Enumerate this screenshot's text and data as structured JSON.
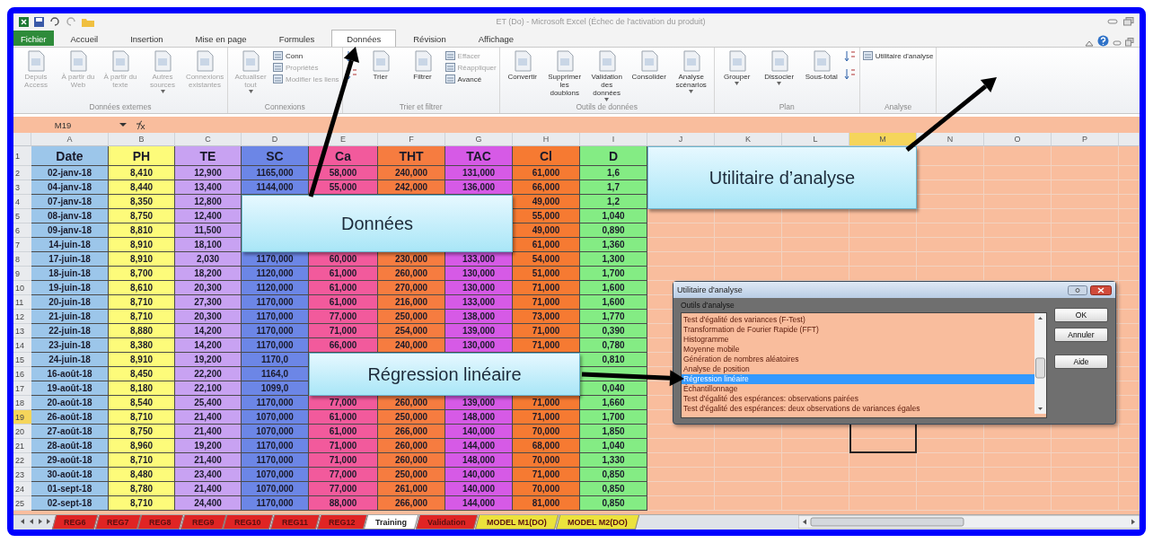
{
  "window": {
    "title": "ET (Do)  -  Microsoft Excel (Échec de l'activation du produit)"
  },
  "ribbon_tabs": [
    {
      "label": "Fichier",
      "kind": "file",
      "selected": false
    },
    {
      "label": "Accueil",
      "kind": "tab",
      "selected": false
    },
    {
      "label": "Insertion",
      "kind": "tab",
      "selected": false
    },
    {
      "label": "Mise en page",
      "kind": "tab",
      "selected": false
    },
    {
      "label": "Formules",
      "kind": "tab",
      "selected": false
    },
    {
      "label": "Données",
      "kind": "tab",
      "selected": true
    },
    {
      "label": "Révision",
      "kind": "tab",
      "selected": false
    },
    {
      "label": "Affichage",
      "kind": "tab",
      "selected": false
    }
  ],
  "ribbon_groups": [
    {
      "label": "Données externes",
      "items": [
        {
          "kind": "large",
          "label": "Depuis Access",
          "disabled": true,
          "dropdown": false
        },
        {
          "kind": "large",
          "label": "À partir du Web",
          "disabled": true,
          "dropdown": false
        },
        {
          "kind": "large",
          "label": "À partir du texte",
          "disabled": true,
          "dropdown": false
        },
        {
          "kind": "large",
          "label": "Autres sources",
          "disabled": true,
          "dropdown": true
        },
        {
          "kind": "large",
          "label": "Connexions existantes",
          "disabled": true,
          "dropdown": false
        }
      ]
    },
    {
      "label": "Connexions",
      "items": [
        {
          "kind": "large",
          "label": "Actualiser tout",
          "disabled": true,
          "dropdown": true
        },
        {
          "kind": "stack",
          "items": [
            {
              "label": "Conn",
              "disabled": false
            },
            {
              "label": "Propriétés",
              "disabled": true
            },
            {
              "label": "Modifier les liens",
              "disabled": true
            }
          ]
        }
      ]
    },
    {
      "label": "Trier et filtrer",
      "items": [
        {
          "kind": "sort"
        },
        {
          "kind": "large",
          "label": "Trier",
          "disabled": false,
          "dropdown": false
        },
        {
          "kind": "large",
          "label": "Filtrer",
          "disabled": false,
          "dropdown": false
        },
        {
          "kind": "stack",
          "items": [
            {
              "label": "Effacer",
              "disabled": true
            },
            {
              "label": "Réappliquer",
              "disabled": true
            },
            {
              "label": "Avancé",
              "disabled": false
            }
          ]
        }
      ]
    },
    {
      "label": "Outils de données",
      "items": [
        {
          "kind": "large",
          "label": "Convertir",
          "disabled": false,
          "dropdown": false
        },
        {
          "kind": "large",
          "label": "Supprimer les doublons",
          "disabled": false,
          "dropdown": false
        },
        {
          "kind": "large",
          "label": "Validation des données",
          "disabled": false,
          "dropdown": true
        },
        {
          "kind": "large",
          "label": "Consolider",
          "disabled": false,
          "dropdown": false
        },
        {
          "kind": "large",
          "label": "Analyse scénarios",
          "disabled": false,
          "dropdown": true
        }
      ]
    },
    {
      "label": "Plan",
      "items": [
        {
          "kind": "large",
          "label": "Grouper",
          "disabled": false,
          "dropdown": true
        },
        {
          "kind": "large",
          "label": "Dissocier",
          "disabled": false,
          "dropdown": true
        },
        {
          "kind": "large",
          "label": "Sous-total",
          "disabled": false,
          "dropdown": false
        },
        {
          "kind": "sort"
        }
      ]
    },
    {
      "label": "Analyse",
      "items": [
        {
          "kind": "stack",
          "items": [
            {
              "label": "Utilitaire d'analyse",
              "disabled": false
            }
          ]
        }
      ]
    }
  ],
  "formula_bar": {
    "name_box": "M19"
  },
  "columns": [
    {
      "label": "A",
      "selected": false
    },
    {
      "label": "B",
      "selected": false
    },
    {
      "label": "C",
      "selected": false
    },
    {
      "label": "D",
      "selected": false
    },
    {
      "label": "E",
      "selected": false
    },
    {
      "label": "F",
      "selected": false
    },
    {
      "label": "G",
      "selected": false
    },
    {
      "label": "H",
      "selected": false
    },
    {
      "label": "I",
      "selected": false
    },
    {
      "label": "J",
      "selected": false
    },
    {
      "label": "K",
      "selected": false
    },
    {
      "label": "L",
      "selected": false
    },
    {
      "label": "M",
      "selected": true
    },
    {
      "label": "N",
      "selected": false
    },
    {
      "label": "O",
      "selected": false
    },
    {
      "label": "P",
      "selected": false
    }
  ],
  "rows": [
    {
      "number": "1",
      "selected": false,
      "cells": [
        "Date",
        "PH",
        "TE",
        "SC",
        "Ca",
        "THT",
        "TAC",
        "Cl",
        "D"
      ]
    },
    {
      "number": "2",
      "selected": false,
      "cells": [
        "02-janv-18",
        "8,410",
        "12,900",
        "1165,000",
        "58,000",
        "240,000",
        "131,000",
        "61,000",
        "1,6"
      ]
    },
    {
      "number": "3",
      "selected": false,
      "cells": [
        "04-janv-18",
        "8,440",
        "13,400",
        "1144,000",
        "55,000",
        "242,000",
        "136,000",
        "66,000",
        "1,7"
      ]
    },
    {
      "number": "4",
      "selected": false,
      "cells": [
        "07-janv-18",
        "8,350",
        "12,800",
        null,
        null,
        null,
        null,
        "49,000",
        "1,2"
      ]
    },
    {
      "number": "5",
      "selected": false,
      "cells": [
        "08-janv-18",
        "8,750",
        "12,400",
        null,
        null,
        null,
        null,
        "55,000",
        "1,040"
      ]
    },
    {
      "number": "6",
      "selected": false,
      "cells": [
        "09-janv-18",
        "8,810",
        "11,500",
        null,
        null,
        null,
        null,
        "49,000",
        "0,890"
      ]
    },
    {
      "number": "7",
      "selected": false,
      "cells": [
        "14-juin-18",
        "8,910",
        "18,100",
        null,
        null,
        null,
        null,
        "61,000",
        "1,360"
      ]
    },
    {
      "number": "8",
      "selected": false,
      "cells": [
        "17-juin-18",
        "8,910",
        "2,030",
        "1170,000",
        "60,000",
        "230,000",
        "133,000",
        "54,000",
        "1,300"
      ]
    },
    {
      "number": "9",
      "selected": false,
      "cells": [
        "18-juin-18",
        "8,700",
        "18,200",
        "1120,000",
        "61,000",
        "260,000",
        "130,000",
        "51,000",
        "1,700"
      ]
    },
    {
      "number": "10",
      "selected": false,
      "cells": [
        "19-juin-18",
        "8,610",
        "20,300",
        "1120,000",
        "61,000",
        "270,000",
        "130,000",
        "71,000",
        "1,600"
      ]
    },
    {
      "number": "11",
      "selected": false,
      "cells": [
        "20-juin-18",
        "8,710",
        "27,300",
        "1170,000",
        "61,000",
        "216,000",
        "133,000",
        "71,000",
        "1,600"
      ]
    },
    {
      "number": "12",
      "selected": false,
      "cells": [
        "21-juin-18",
        "8,710",
        "20,300",
        "1170,000",
        "77,000",
        "250,000",
        "138,000",
        "73,000",
        "1,770"
      ]
    },
    {
      "number": "13",
      "selected": false,
      "cells": [
        "22-juin-18",
        "8,880",
        "14,200",
        "1170,000",
        "71,000",
        "254,000",
        "139,000",
        "71,000",
        "0,390"
      ]
    },
    {
      "number": "14",
      "selected": false,
      "cells": [
        "23-juin-18",
        "8,380",
        "14,200",
        "1170,000",
        "66,000",
        "240,000",
        "130,000",
        "71,000",
        "0,780"
      ]
    },
    {
      "number": "15",
      "selected": false,
      "cells": [
        "24-juin-18",
        "8,910",
        "19,200",
        "1170,0",
        null,
        null,
        null,
        null,
        "0,810"
      ]
    },
    {
      "number": "16",
      "selected": false,
      "cells": [
        "16-août-18",
        "8,450",
        "22,200",
        "1164,0",
        null,
        null,
        null,
        null,
        null
      ]
    },
    {
      "number": "17",
      "selected": false,
      "cells": [
        "19-août-18",
        "8,180",
        "22,100",
        "1099,0",
        null,
        null,
        null,
        null,
        "0,040"
      ]
    },
    {
      "number": "18",
      "selected": false,
      "cells": [
        "20-août-18",
        "8,540",
        "25,400",
        "1170,000",
        "77,000",
        "260,000",
        "139,000",
        "71,000",
        "1,660"
      ]
    },
    {
      "number": "19",
      "selected": true,
      "cells": [
        "26-août-18",
        "8,710",
        "21,400",
        "1070,000",
        "61,000",
        "250,000",
        "148,000",
        "71,000",
        "1,700"
      ]
    },
    {
      "number": "20",
      "selected": false,
      "cells": [
        "27-août-18",
        "8,750",
        "21,400",
        "1070,000",
        "61,000",
        "266,000",
        "140,000",
        "70,000",
        "1,850"
      ]
    },
    {
      "number": "21",
      "selected": false,
      "cells": [
        "28-août-18",
        "8,960",
        "19,200",
        "1170,000",
        "71,000",
        "260,000",
        "144,000",
        "68,000",
        "1,040"
      ]
    },
    {
      "number": "22",
      "selected": false,
      "cells": [
        "29-août-18",
        "8,710",
        "21,400",
        "1170,000",
        "71,000",
        "260,000",
        "148,000",
        "70,000",
        "1,330"
      ]
    },
    {
      "number": "23",
      "selected": false,
      "cells": [
        "30-août-18",
        "8,480",
        "23,400",
        "1070,000",
        "77,000",
        "250,000",
        "140,000",
        "71,000",
        "0,850"
      ]
    },
    {
      "number": "24",
      "selected": false,
      "cells": [
        "01-sept-18",
        "8,780",
        "21,400",
        "1070,000",
        "77,000",
        "261,000",
        "140,000",
        "70,000",
        "0,850"
      ]
    },
    {
      "number": "25",
      "selected": false,
      "cells": [
        "02-sept-18",
        "8,710",
        "24,400",
        "1170,000",
        "88,000",
        "266,000",
        "144,000",
        "81,000",
        "0,850"
      ]
    }
  ],
  "callouts": [
    {
      "text": "Données"
    },
    {
      "text": "Utilitaire d’analyse"
    },
    {
      "text": "Régression linéaire"
    }
  ],
  "dialog": {
    "title": "Utilitaire d'analyse",
    "label": "Outils d'analyse",
    "items": [
      {
        "label": "Test d'égalité des variances (F-Test)",
        "selected": false
      },
      {
        "label": "Transformation de Fourier Rapide (FFT)",
        "selected": false
      },
      {
        "label": "Histogramme",
        "selected": false
      },
      {
        "label": "Moyenne mobile",
        "selected": false
      },
      {
        "label": "Génération de nombres aléatoires",
        "selected": false
      },
      {
        "label": "Analyse de position",
        "selected": false
      },
      {
        "label": "Régression linéaire",
        "selected": true
      },
      {
        "label": "Échantillonnage",
        "selected": false
      },
      {
        "label": "Test d'égalité des espérances: observations pairées",
        "selected": false
      },
      {
        "label": "Test d'égalité des espérances: deux observations de variances égales",
        "selected": false
      }
    ],
    "buttons": [
      "OK",
      "Annuler",
      "Aide"
    ]
  },
  "sheet_tabs": [
    {
      "label": "REG6",
      "color": "#e02424",
      "selected": false
    },
    {
      "label": "REG7",
      "color": "#e02424",
      "selected": false
    },
    {
      "label": "REG8",
      "color": "#e02424",
      "selected": false
    },
    {
      "label": "REG9",
      "color": "#e02424",
      "selected": false
    },
    {
      "label": "REG10",
      "color": "#e02424",
      "selected": false
    },
    {
      "label": "REG11",
      "color": "#e02424",
      "selected": false
    },
    {
      "label": "REG12",
      "color": "#e02424",
      "selected": false
    },
    {
      "label": "Training",
      "selected": true
    },
    {
      "label": "Validation",
      "color": "#e02424",
      "selected": false
    },
    {
      "label": "MODEL M1(DO)",
      "color": "#ece23c",
      "selected": false
    },
    {
      "label": "MODEL M2(DO)",
      "color": "#ece23c",
      "selected": false
    }
  ]
}
